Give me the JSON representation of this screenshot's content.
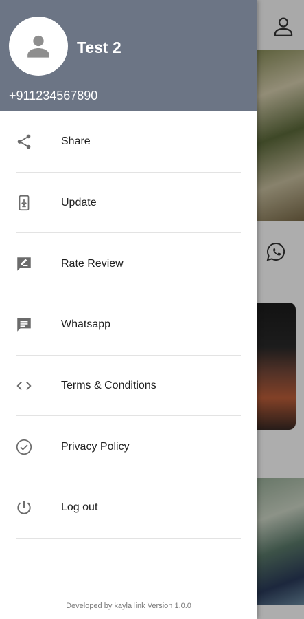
{
  "user": {
    "name": "Test 2",
    "phone": "+911234567890"
  },
  "menu": {
    "items": [
      {
        "label": "Share",
        "icon": "share-icon"
      },
      {
        "label": "Update",
        "icon": "update-icon"
      },
      {
        "label": "Rate Review",
        "icon": "rate-review-icon"
      },
      {
        "label": "Whatsapp",
        "icon": "chat-icon"
      },
      {
        "label": "Terms & Conditions",
        "icon": "code-icon"
      },
      {
        "label": "Privacy Policy",
        "icon": "check-circle-icon"
      },
      {
        "label": "Log out",
        "icon": "power-icon"
      }
    ]
  },
  "footer": {
    "text": "Developed by kayla link  Version 1.0.0"
  },
  "colors": {
    "header_bg": "#6c7585",
    "icon_gray": "#6b6b6b",
    "scrim": "rgba(0,0,0,0.32)"
  }
}
